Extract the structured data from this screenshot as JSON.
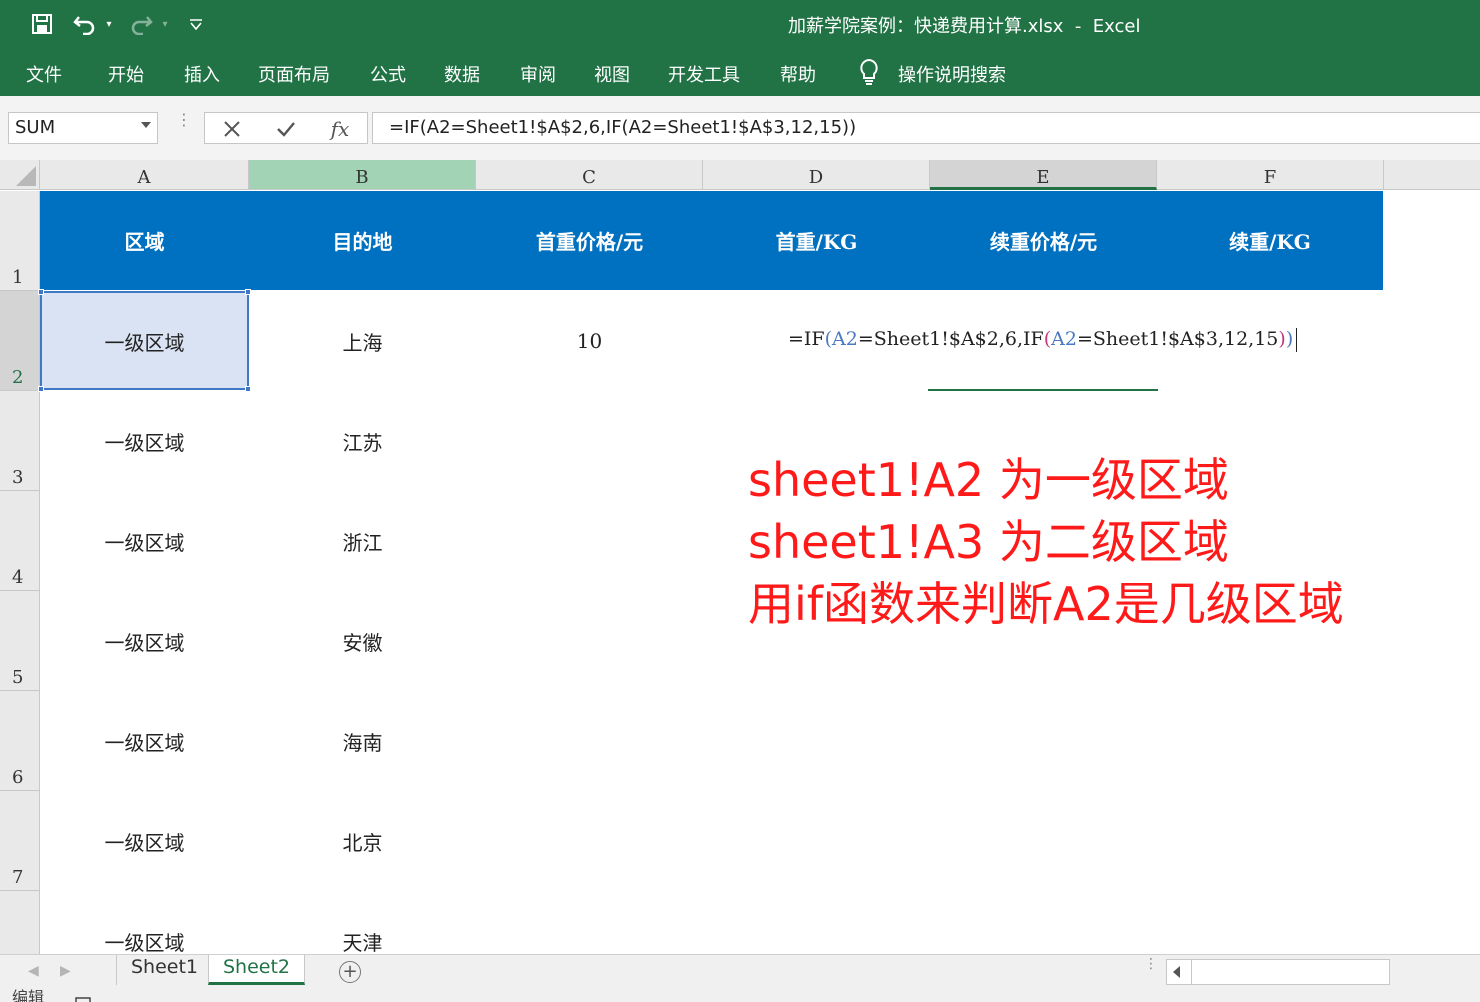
{
  "window": {
    "title": "加薪学院案例：快递费用计算.xlsx  -  Excel"
  },
  "ribbon": {
    "tabs": [
      "文件",
      "开始",
      "插入",
      "页面布局",
      "公式",
      "数据",
      "审阅",
      "视图",
      "开发工具",
      "帮助"
    ],
    "tell_me": "操作说明搜索"
  },
  "formula_bar": {
    "name_box": "SUM",
    "fx_label": "fx",
    "formula": "=IF(A2=Sheet1!$A$2,6,IF(A2=Sheet1!$A$3,12,15))"
  },
  "grid": {
    "columns": [
      "A",
      "B",
      "C",
      "D",
      "E",
      "F"
    ],
    "rows": [
      "1",
      "2",
      "3",
      "4",
      "5",
      "6",
      "7"
    ],
    "headers": [
      "区域",
      "目的地",
      "首重价格/元",
      "首重/KG",
      "续重价格/元",
      "续重/KG"
    ],
    "data_rows": [
      {
        "region": "一级区域",
        "dest": "上海",
        "price": "10"
      },
      {
        "region": "一级区域",
        "dest": "江苏",
        "price": ""
      },
      {
        "region": "一级区域",
        "dest": "浙江",
        "price": ""
      },
      {
        "region": "一级区域",
        "dest": "安徽",
        "price": ""
      },
      {
        "region": "一级区域",
        "dest": "海南",
        "price": ""
      },
      {
        "region": "一级区域",
        "dest": "北京",
        "price": ""
      },
      {
        "region": "一级区域",
        "dest": "天津",
        "price": ""
      }
    ],
    "editing_formula": {
      "part1": "=IF",
      "paren1": "(",
      "ref1": "A2",
      "part2": "=Sheet1!$A$2,6,IF",
      "paren2": "(",
      "ref2": "A2",
      "part3": "=Sheet1!$A$3,12,15",
      "close2": ")",
      "close1": ")"
    }
  },
  "annotation": {
    "lines": [
      "sheet1!A2 为一级区域",
      "sheet1!A3 为二级区域",
      "用if函数来判断A2是几级区域"
    ],
    "color": "#ff1a1a"
  },
  "sheet_tabs": {
    "tabs": [
      "Sheet1",
      "Sheet2"
    ],
    "active": "Sheet2"
  },
  "status": {
    "mode": "编辑"
  },
  "colors": {
    "excel_green": "#217346",
    "header_blue": "#0070c0",
    "selection_fill": "#d9e3f3"
  }
}
